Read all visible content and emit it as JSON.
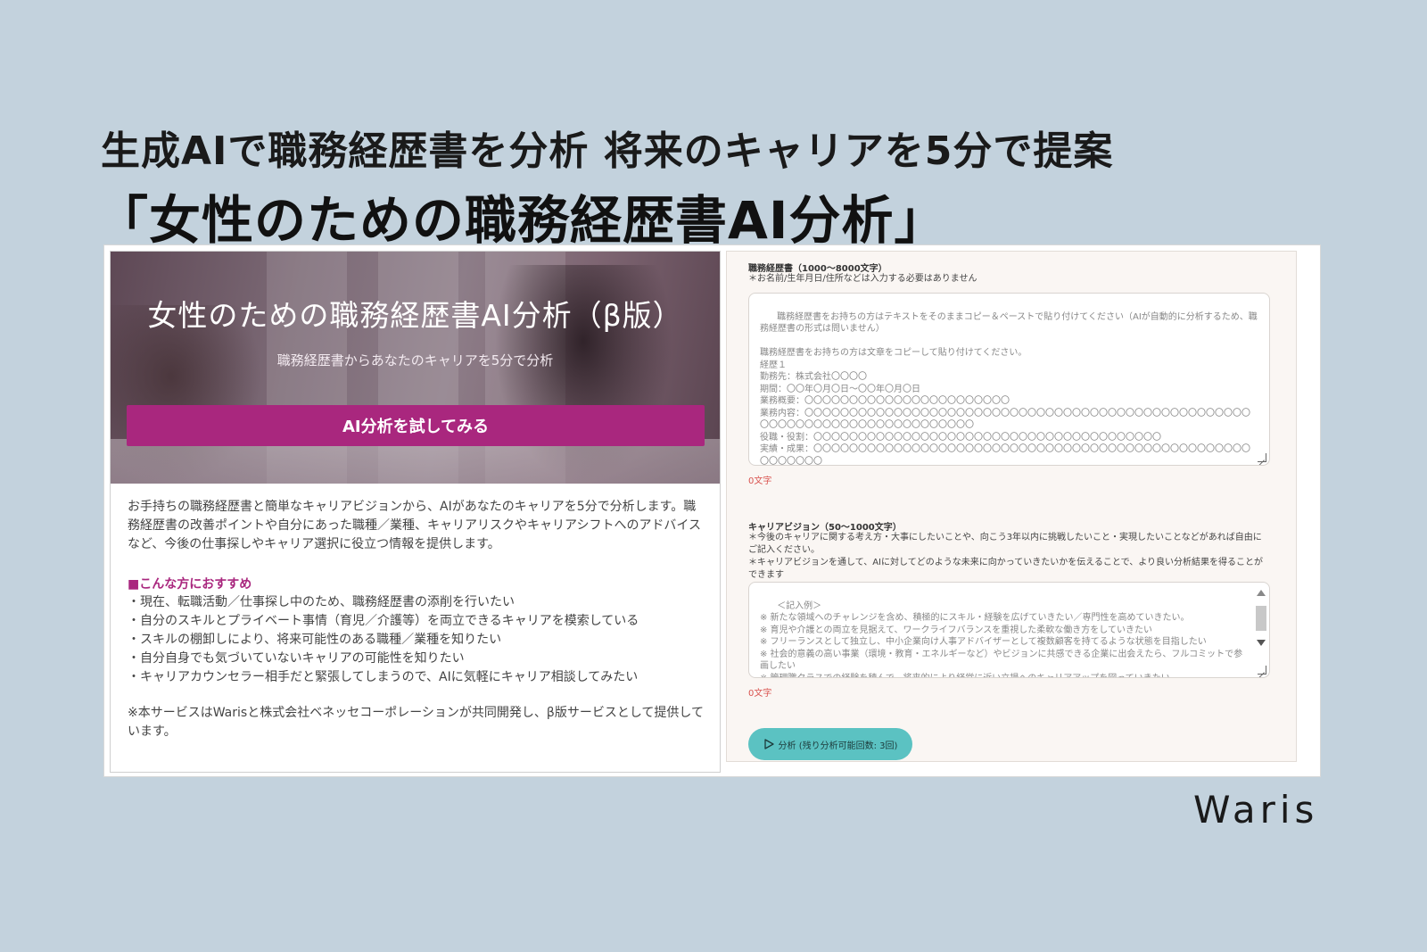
{
  "headline": {
    "line1": "生成AIで職務経歴書を分析 将来のキャリアを5分で提案",
    "line2": "「女性のための職務経歴書AI分析」"
  },
  "left_panel": {
    "hero_title": "女性のための職務経歴書AI分析（β版）",
    "hero_subtitle": "職務経歴書からあなたのキャリアを5分で分析",
    "cta_label": "AI分析を試してみる",
    "description": "お手持ちの職務経歴書と簡単なキャリアビジョンから、AIがあなたのキャリアを5分で分析します。職務経歴書の改善ポイントや自分にあった職種／業種、キャリアリスクやキャリアシフトへのアドバイスなど、今後の仕事探しやキャリア選択に役立つ情報を提供します。",
    "recommend_title": "■こんな方におすすめ",
    "recommend_items": [
      "・現在、転職活動／仕事探し中のため、職務経歴書の添削を行いたい",
      "・自分のスキルとプライベート事情（育児／介護等）を両立できるキャリアを模索している",
      "・スキルの棚卸しにより、将来可能性のある職種／業種を知りたい",
      "・自分自身でも気づいていないキャリアの可能性を知りたい",
      "・キャリアカウンセラー相手だと緊張してしまうので、AIに気軽にキャリア相談してみたい"
    ],
    "note": "※本サービスはWarisと株式会社ベネッセコーポレーションが共同開発し、β版サービスとして提供しています。"
  },
  "right_panel": {
    "resume_label": "職務経歴書（1000〜8000文字）",
    "resume_note": "＊お名前/生年月日/住所などは入力する必要はありません",
    "resume_placeholder": "職務経歴書をお持ちの方はテキストをそのままコピー＆ペーストで貼り付けてください（AIが自動的に分析するため、職務経歴書の形式は問いません）\n\n職務経歴書をお持ちの方は文章をコピーして貼り付けてください。\n経歴１\n勤務先：株式会社〇〇〇〇\n期間：〇〇年〇月〇日〜〇〇年〇月〇日\n業務概要：〇〇〇〇〇〇〇〇〇〇〇〇〇〇〇〇〇〇〇〇〇〇〇\n業務内容：〇〇〇〇〇〇〇〇〇〇〇〇〇〇〇〇〇〇〇〇〇〇〇〇〇〇〇〇〇〇〇〇〇〇〇〇〇〇〇〇〇〇〇〇〇〇〇〇〇〇〇〇〇〇〇〇〇〇〇〇〇〇〇〇〇〇〇〇〇〇〇〇〇〇\n役職・役割：〇〇〇〇〇〇〇〇〇〇〇〇〇〇〇〇〇〇〇〇〇〇〇〇〇〇〇〇〇〇〇〇〇〇〇〇〇〇〇\n実績・成果：〇〇〇〇〇〇〇〇〇〇〇〇〇〇〇〇〇〇〇〇〇〇〇〇〇〇〇〇〇〇〇〇〇〇〇〇〇〇〇〇〇〇〇〇〇〇〇〇〇〇〇〇〇〇〇〇",
    "resume_count": "0文字",
    "vision_label": "キャリアビジョン（50〜1000文字）",
    "vision_note1": "＊今後のキャリアに関する考え方・大事にしたいことや、向こう3年以内に挑戦したいこと・実現したいことなどがあれば自由にご記入ください。",
    "vision_note2": "＊キャリアビジョンを通して、AIに対してどのような未来に向かっていきたいかを伝えることで、より良い分析結果を得ることができます",
    "vision_placeholder": "＜記入例＞\n※ 新たな領域へのチャレンジを含め、積極的にスキル・経験を広げていきたい／専門性を高めていきたい。\n※ 育児や介護との両立を見据えて、ワークライフバランスを重視した柔軟な働き方をしていきたい\n※ フリーランスとして独立し、中小企業向け人事アドバイザーとして複数顧客を持てるような状態を目指したい\n※ 社会的意義の高い事業（環境・教育・エネルギーなど）やビジョンに共感できる企業に出会えたら、フルコミットで参画したい\n※ 管理職クラスでの経験を積んで、将来的により経営に近い立場へのキャリアアップを図っていきたい",
    "vision_count": "0文字",
    "analyze_label": "分析 (残り分析可能回数: 3回)"
  },
  "brand": "Waris",
  "colors": {
    "background": "#c3d2dd",
    "accent": "#a9277e",
    "analyze_button": "#5bc2c2",
    "counter": "#d9534f"
  },
  "icons": {
    "analyze": "play-icon"
  }
}
